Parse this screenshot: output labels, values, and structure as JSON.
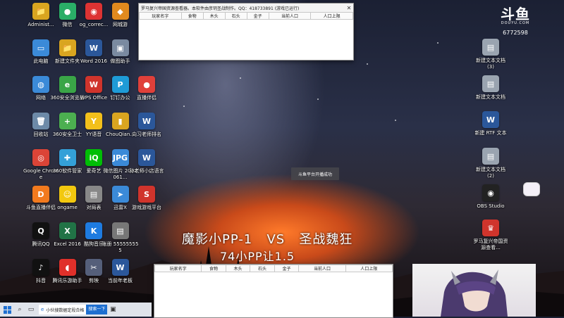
{
  "desktop": {
    "left_icons": [
      {
        "label": "Administ...",
        "glyph": "📁",
        "color": "#d9a520"
      },
      {
        "label": "微信",
        "glyph": "●",
        "color": "#2aae67"
      },
      {
        "label": "og_correc...",
        "glyph": "◉",
        "color": "#d33"
      },
      {
        "label": "网城游",
        "glyph": "◆",
        "color": "#e08a1e"
      },
      {
        "label": "此电脑",
        "glyph": "▭",
        "color": "#3b8ad8"
      },
      {
        "label": "新建文件夹",
        "glyph": "📁",
        "color": "#d9a520"
      },
      {
        "label": "Word 2016",
        "glyph": "W",
        "color": "#2b579a"
      },
      {
        "label": "做图助手",
        "glyph": "▣",
        "color": "#7a8aa0"
      },
      {
        "label": "网络",
        "glyph": "◍",
        "color": "#3b8ad8"
      },
      {
        "label": "360安全浏览器",
        "glyph": "e",
        "color": "#3aa547"
      },
      {
        "label": "WPS Office",
        "glyph": "W",
        "color": "#d0342c"
      },
      {
        "label": "钉钉办公",
        "glyph": "P",
        "color": "#1e9bd7"
      },
      {
        "label": "直播伴侣",
        "glyph": "●",
        "color": "#e0403a"
      },
      {
        "label": "回收站",
        "glyph": "🗑",
        "color": "#6d8aa8"
      },
      {
        "label": "360安全卫士",
        "glyph": "+",
        "color": "#4caf50"
      },
      {
        "label": "YY语音",
        "glyph": "Y",
        "color": "#f3c01b"
      },
      {
        "label": "ChouQian...",
        "glyph": "▮",
        "color": "#d9a520"
      },
      {
        "label": "向习老师排名",
        "glyph": "W",
        "color": "#2b579a"
      },
      {
        "label": "Google Chrome",
        "glyph": "◎",
        "color": "#db4437"
      },
      {
        "label": "360软件管家",
        "glyph": "✚",
        "color": "#34a0d8"
      },
      {
        "label": "爱奇艺",
        "glyph": "iQ",
        "color": "#00be06"
      },
      {
        "label": "微信图片 2022061...",
        "glyph": "JPG",
        "color": "#3b8ad8"
      },
      {
        "label": "孙老师小店语言",
        "glyph": "W",
        "color": "#2b579a"
      },
      {
        "label": "斗鱼直播伴侣",
        "glyph": "D",
        "color": "#f27a1e"
      },
      {
        "label": "ongame",
        "glyph": "☺",
        "color": "#f2c80f"
      },
      {
        "label": "对局表",
        "glyph": "▤",
        "color": "#888888"
      },
      {
        "label": "迅雷X",
        "glyph": "➤",
        "color": "#3b8ad8"
      },
      {
        "label": "游戏游戏平台",
        "glyph": "S",
        "color": "#d0342c"
      },
      {
        "label": "腾讯QQ",
        "glyph": "Q",
        "color": "#111111"
      },
      {
        "label": "Excel 2016",
        "glyph": "X",
        "color": "#217346"
      },
      {
        "label": "酷狗音乐",
        "glyph": "K",
        "color": "#1e7be0"
      },
      {
        "label": "账册 555555555",
        "glyph": "▤",
        "color": "#777777"
      },
      {
        "label": "抖音",
        "glyph": "♪",
        "color": "#111111"
      },
      {
        "label": "腾讯乐游助手",
        "glyph": "◖",
        "color": "#e0302a"
      },
      {
        "label": "剪映",
        "glyph": "✂",
        "color": "#555f7a"
      },
      {
        "label": "当前年老板",
        "glyph": "W",
        "color": "#2b579a"
      }
    ],
    "right_icons": [
      {
        "label": "新建文本文档 (3)",
        "glyph": "▤",
        "color": "#9aa4b0"
      },
      {
        "label": "新建文本文档",
        "glyph": "▤",
        "color": "#9aa4b0"
      },
      {
        "label": "新建 RTF 文本",
        "glyph": "W",
        "color": "#2b579a"
      },
      {
        "label": "新建文本文档 (2)",
        "glyph": "▤",
        "color": "#9aa4b0"
      },
      {
        "label": "OBS Studio",
        "glyph": "◉",
        "color": "#222222"
      },
      {
        "label": "罗马复兴帝国资源查看...",
        "glyph": "♛",
        "color": "#d0342c"
      }
    ]
  },
  "window_top": {
    "title": "罗马复兴帝国资源查看器。本软件由彦玥圣战制作。QQ：418733891 (游戏已运行)",
    "columns": [
      "玩家名字",
      "食物",
      "木头",
      "石头",
      "金子",
      "当前人口",
      "人口上限"
    ]
  },
  "window_bottom": {
    "columns": [
      "玩家名字",
      "食物",
      "木头",
      "石头",
      "金子",
      "当前人口",
      "人口上限"
    ]
  },
  "overlay": {
    "toast": "斗鱼平台开播成功",
    "match_left": "魔影小PP-1",
    "versus": "VS",
    "match_right": "圣战魏狂",
    "handicap": "74小PP让1.5"
  },
  "douyu": {
    "logo": "斗鱼",
    "sub": "DOUYU.COM",
    "room_id": "6772598"
  },
  "taskbar": {
    "search_text": "小伙搜数据定段合格",
    "search_button": "搜索一下"
  }
}
